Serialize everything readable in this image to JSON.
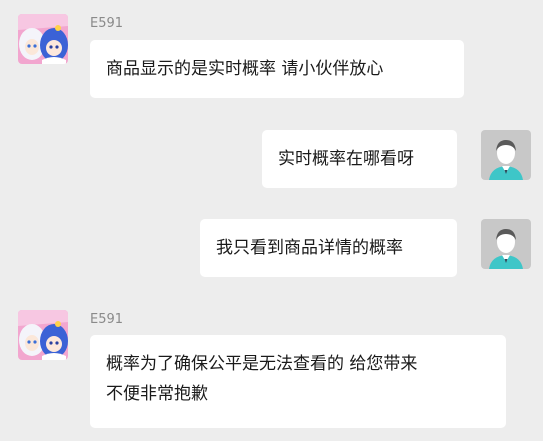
{
  "messages": [
    {
      "side": "left",
      "sender": "E591",
      "avatar_icon": "anime-girl-avatar-icon",
      "lines": [
        "商品显示的是实时概率 请小伙伴放心"
      ]
    },
    {
      "side": "right",
      "avatar_icon": "user-avatar-icon",
      "lines": [
        "实时概率在哪看呀"
      ]
    },
    {
      "side": "right",
      "avatar_icon": "user-avatar-icon",
      "lines": [
        "我只看到商品详情的概率"
      ]
    },
    {
      "side": "left",
      "sender": "E591",
      "avatar_icon": "anime-girl-avatar-icon",
      "lines": [
        "概率为了确保公平是无法查看的 给您带来",
        "不便非常抱歉"
      ]
    }
  ],
  "colors": {
    "background": "#ededed",
    "bubble": "#ffffff",
    "text": "#1a1a1a",
    "sender_name": "#8a8a8a",
    "user_avatar_bg": "#c8c8c8",
    "user_avatar_shirt": "#3ec6c8",
    "anime_avatar_bg": "#f2a6cf"
  }
}
